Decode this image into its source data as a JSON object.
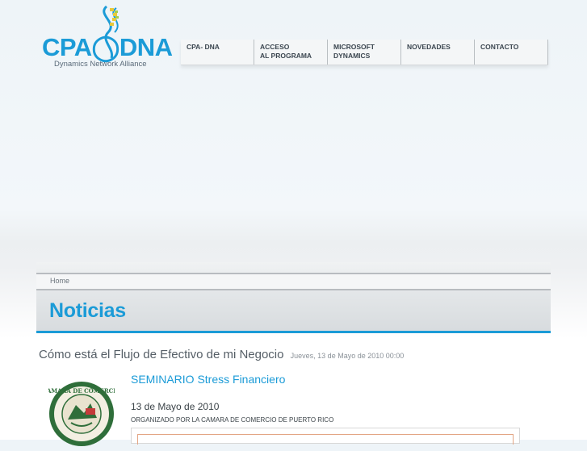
{
  "logo": {
    "text_pre": "CPA",
    "text_post": "DNA",
    "subtitle": "Dynamics Network Alliance",
    "color": "#1b9bd7",
    "helix_color": "#1b9bd7",
    "accent_color": "#e8c93a"
  },
  "nav": {
    "items": [
      {
        "label": "CPA- DNA"
      },
      {
        "label": "ACCESO\nAL PROGRAMA"
      },
      {
        "label": "MICROSOFT\nDYNAMICS"
      },
      {
        "label": "NOVEDADES"
      },
      {
        "label": "CONTACTO"
      }
    ]
  },
  "breadcrumb": {
    "home": "Home"
  },
  "page": {
    "title": "Noticias"
  },
  "article": {
    "title": "Cómo está el Flujo de Efectivo de mi Negocio",
    "date": "Jueves, 13 de Mayo de 2010 00:00",
    "seminar_link": "SEMINARIO Stress Financiero",
    "event_date": "13 de Mayo de 2010",
    "organizer": "ORGANIZADO POR LA CAMARA DE COMERCIO DE PUERTO RICO",
    "seal_alt": "Camara de Comercio de Puerto Rico seal"
  },
  "colors": {
    "accent": "#1b9bd7",
    "text": "#555e66"
  }
}
